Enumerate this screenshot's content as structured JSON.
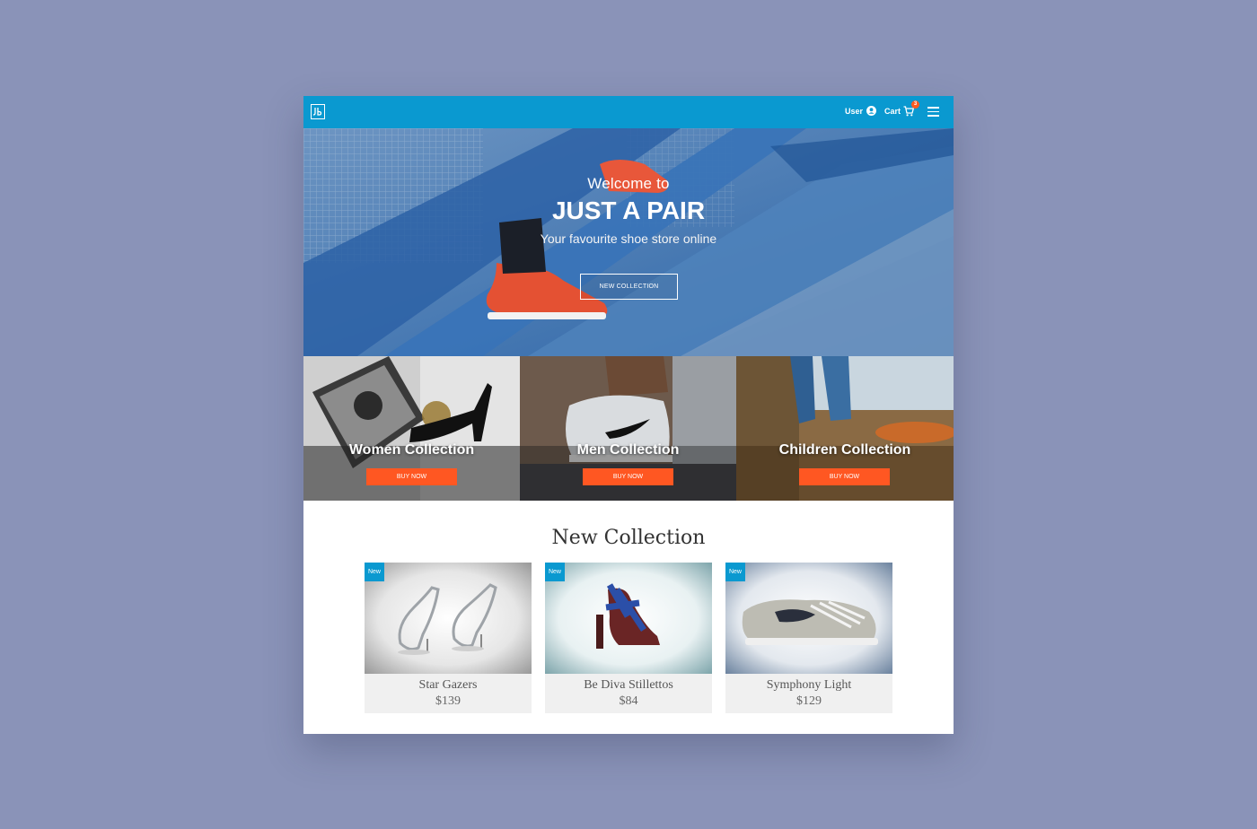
{
  "nav": {
    "user_label": "User",
    "cart_label": "Cart",
    "cart_count": "3",
    "accent_color": "#0a99d0"
  },
  "hero": {
    "welcome": "Welcome to",
    "title": "JUST A PAIR",
    "subtitle": "Your favourite shoe store online",
    "button_label": "NEW COLLECTION"
  },
  "collections": [
    {
      "title": "Women Collection",
      "button_label": "BUY NOW"
    },
    {
      "title": "Men Collection",
      "button_label": "BUY NOW"
    },
    {
      "title": "Children Collection",
      "button_label": "BUY NOW"
    }
  ],
  "new_collection": {
    "title": "New Collection",
    "products": [
      {
        "badge": "New",
        "name": "Star Gazers",
        "price": "$139"
      },
      {
        "badge": "New",
        "name": "Be Diva Stillettos",
        "price": "$84"
      },
      {
        "badge": "New",
        "name": "Symphony Light",
        "price": "$129"
      }
    ]
  },
  "colors": {
    "button_orange": "#ff5722",
    "page_background": "#8a93b8"
  }
}
